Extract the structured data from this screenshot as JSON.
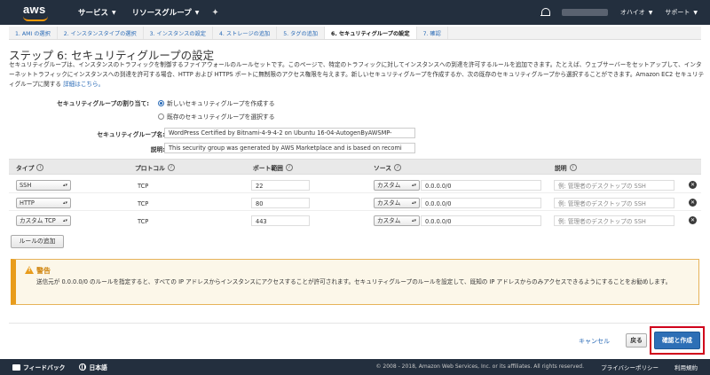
{
  "topnav": {
    "logo": "aws",
    "services_label": "サービス",
    "resource_groups_label": "リソースグループ",
    "region_label": "オハイオ",
    "support_label": "サポート"
  },
  "tabs": [
    {
      "label": "1. AMI の選択",
      "active": false
    },
    {
      "label": "2. インスタンスタイプの選択",
      "active": false
    },
    {
      "label": "3. インスタンスの設定",
      "active": false
    },
    {
      "label": "4. ストレージの追加",
      "active": false
    },
    {
      "label": "5. タグの追加",
      "active": false
    },
    {
      "label": "6. セキュリティグループの設定",
      "active": true
    },
    {
      "label": "7. 確認",
      "active": false
    }
  ],
  "page": {
    "title": "ステップ 6: セキュリティグループの設定",
    "description": "セキュリティグループは、インスタンスのトラフィックを制御するファイアウォールのルールセットです。このページで、特定のトラフィックに対してインスタンスへの到達を許可するルールを追加できます。たとえば、ウェブサーバーをセットアップして、インターネットトラフィックにインスタンスへの到達を許可する場合、HTTP および HTTPS ポートに無制限のアクセス権限を与えます。新しいセキュリティグループを作成するか、次の既存のセキュリティグループから選択することができます。Amazon EC2 セキュリティグループに関する",
    "details_link": "詳細はこちら。"
  },
  "assign": {
    "label": "セキュリティグループの割り当て:",
    "option_new": "新しいセキュリティグループを作成する",
    "option_existing": "既存のセキュリティグループを選択する",
    "selected": "new"
  },
  "form": {
    "name_label": "セキュリティグループ名:",
    "name_value": "WordPress Certified by Bitnami-4-9-4-2 on Ubuntu 16-04-AutogenByAWSMP-",
    "desc_label": "説明:",
    "desc_value": "This security group was generated by AWS Marketplace and is based on recomi"
  },
  "table": {
    "headers": {
      "type": "タイプ",
      "protocol": "プロトコル",
      "port_range": "ポート範囲",
      "source": "ソース",
      "description": "説明"
    },
    "rows": [
      {
        "type": "SSH",
        "protocol": "TCP",
        "port": "22",
        "source_mode": "カスタム",
        "source_cidr": "0.0.0.0/0",
        "desc_placeholder": "例: 管理者のデスクトップの SSH"
      },
      {
        "type": "HTTP",
        "protocol": "TCP",
        "port": "80",
        "source_mode": "カスタム",
        "source_cidr": "0.0.0.0/0",
        "desc_placeholder": "例: 管理者のデスクトップの SSH"
      },
      {
        "type": "カスタム TCP",
        "protocol": "TCP",
        "port": "443",
        "source_mode": "カスタム",
        "source_cidr": "0.0.0.0/0",
        "desc_placeholder": "例: 管理者のデスクトップの SSH"
      }
    ],
    "add_rule_label": "ルールの追加"
  },
  "warning": {
    "title": "警告",
    "body": "送信元が 0.0.0.0/0 のルールを指定すると、すべての IP アドレスからインスタンスにアクセスすることが許可されます。セキュリティグループのルールを設定して、既知の IP アドレスからのみアクセスできるようにすることをお勧めします。"
  },
  "actions": {
    "cancel": "キャンセル",
    "back": "戻る",
    "review_launch": "確認と作成"
  },
  "footer": {
    "feedback": "フィードバック",
    "language": "日本語",
    "copyright": "© 2008 - 2018, Amazon Web Services, Inc. or its affiliates. All rights reserved.",
    "privacy": "プライバシーポリシー",
    "terms": "利用規約"
  },
  "colors": {
    "nav_bg": "#232f3e",
    "link": "#2a6bb7",
    "primary": "#2d6fb6",
    "warning_accent": "#e89c1c",
    "highlight": "#d0021b"
  }
}
